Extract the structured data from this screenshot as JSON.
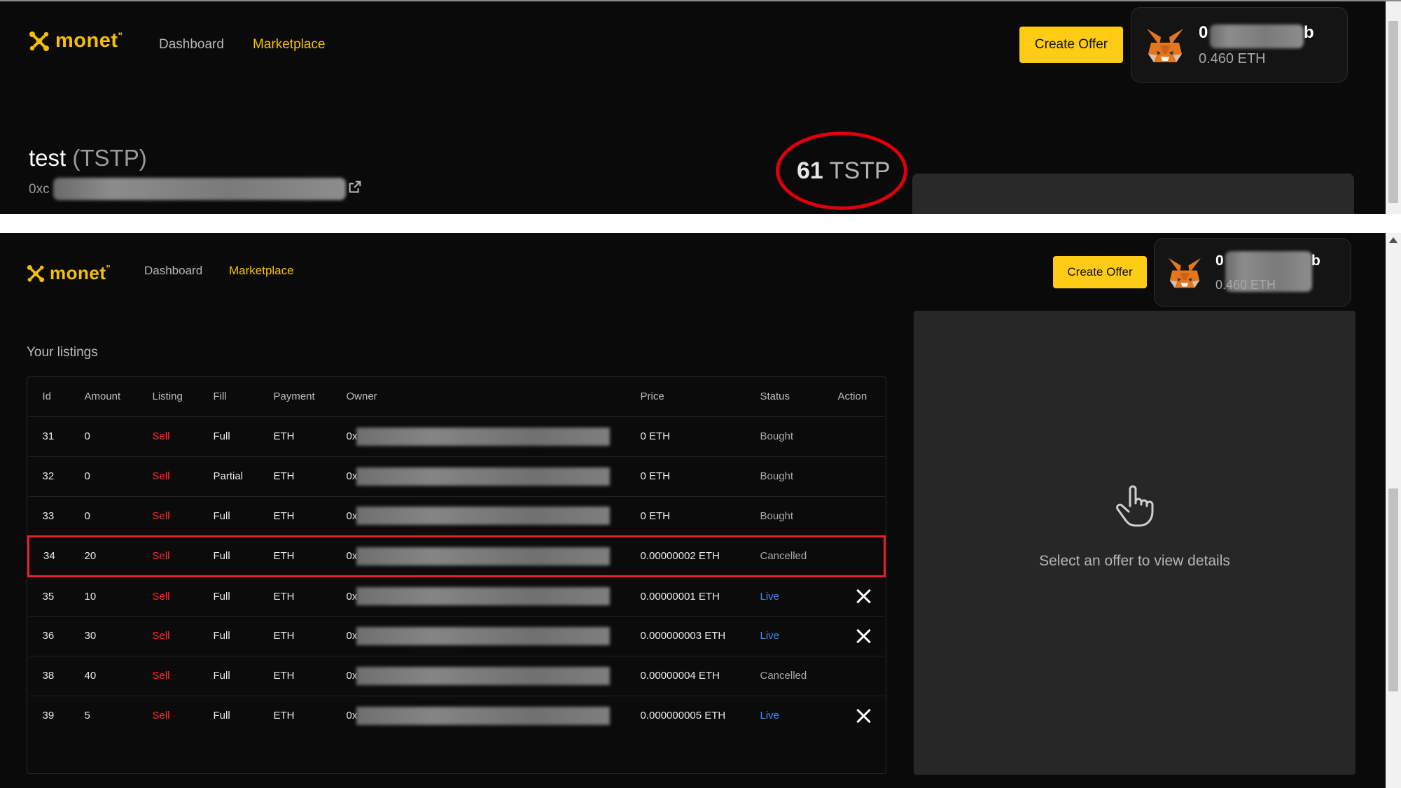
{
  "header": {
    "brand": "monet",
    "nav": [
      "Dashboard",
      "Marketplace"
    ],
    "create_offer": "Create Offer",
    "wallet": {
      "address_prefix": "0",
      "address_suffix": "b",
      "balance": "0.460 ETH"
    }
  },
  "header2": {
    "wallet": {
      "address_prefix": "0",
      "address_suffix": "b",
      "balance": "0.460 ETH"
    }
  },
  "token": {
    "name": "test",
    "symbol": "(TSTP)",
    "address_prefix": "0xc",
    "balance_amount": "61",
    "balance_symbol": "TSTP"
  },
  "listings": {
    "title": "Your listings",
    "columns": [
      "Id",
      "Amount",
      "Listing",
      "Fill",
      "Payment",
      "Owner",
      "Price",
      "Status",
      "Action"
    ],
    "rows": [
      {
        "id": "31",
        "amount": "0",
        "listing": "Sell",
        "fill": "Full",
        "payment": "ETH",
        "owner": "0x",
        "price": "0 ETH",
        "status": "Bought",
        "action": ""
      },
      {
        "id": "32",
        "amount": "0",
        "listing": "Sell",
        "fill": "Partial",
        "payment": "ETH",
        "owner": "0x",
        "price": "0 ETH",
        "status": "Bought",
        "action": ""
      },
      {
        "id": "33",
        "amount": "0",
        "listing": "Sell",
        "fill": "Full",
        "payment": "ETH",
        "owner": "0x",
        "price": "0 ETH",
        "status": "Bought",
        "action": ""
      },
      {
        "id": "34",
        "amount": "20",
        "listing": "Sell",
        "fill": "Full",
        "payment": "ETH",
        "owner": "0x",
        "price": "0.00000002 ETH",
        "status": "Cancelled",
        "action": ""
      },
      {
        "id": "35",
        "amount": "10",
        "listing": "Sell",
        "fill": "Full",
        "payment": "ETH",
        "owner": "0x",
        "price": "0.00000001 ETH",
        "status": "Live",
        "action": "cancel"
      },
      {
        "id": "36",
        "amount": "30",
        "listing": "Sell",
        "fill": "Full",
        "payment": "ETH",
        "owner": "0x",
        "price": "0.000000003 ETH",
        "status": "Live",
        "action": "cancel"
      },
      {
        "id": "38",
        "amount": "40",
        "listing": "Sell",
        "fill": "Full",
        "payment": "ETH",
        "owner": "0x",
        "price": "0.00000004 ETH",
        "status": "Cancelled",
        "action": ""
      },
      {
        "id": "39",
        "amount": "5",
        "listing": "Sell",
        "fill": "Full",
        "payment": "ETH",
        "owner": "0x",
        "price": "0.000000005 ETH",
        "status": "Live",
        "action": "cancel"
      }
    ]
  },
  "detail": {
    "empty_text": "Select an offer to view details"
  },
  "icons": {
    "brand": "monet-logo-icon",
    "wallet": "metamask-fox-icon",
    "external": "external-link-icon",
    "hand": "pointer-hand-icon",
    "close": "close-icon"
  },
  "colors": {
    "accent": "#ffcc15",
    "sell": "#ff2b2b",
    "live": "#3c8cff",
    "annotation": "#e0000b"
  }
}
